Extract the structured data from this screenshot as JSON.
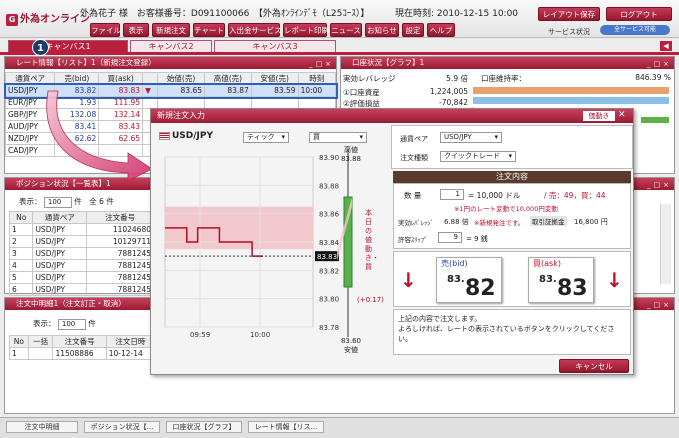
{
  "header": {
    "logo": "外為オンライン",
    "user": "外為花子 様",
    "customer_label": "お客様番号：D091100066",
    "course": "【外為ｵﾝﾗｲﾝﾃﾞﾓ（L25ｺｰｽ）】",
    "time_label": "現在時刻:",
    "time": "2010-12-15 10:00",
    "layout_save": "レイアウト保存",
    "logout": "ログアウト",
    "service_status": "サービス状況",
    "service_badge": "全サービス可能"
  },
  "menu": [
    "ファイル",
    "表示",
    "新規注文",
    "チャート",
    "入出金サービス",
    "レポート印刷",
    "ニュース",
    "お知らせ",
    "設定",
    "ヘルプ"
  ],
  "tabs": [
    "キャンバス1",
    "キャンバス2",
    "キャンバス3"
  ],
  "step_number": "1",
  "rate_panel": {
    "title": "レート情報【リスト】1（新規注文登録）",
    "headers": [
      "通貨ペア",
      "売(bid)",
      "買(ask)",
      "",
      "始値(売)",
      "高値(売)",
      "安値(売)",
      "時刻"
    ],
    "rows": [
      {
        "pair": "USD/JPY",
        "bid": "83.82",
        "ask": "83.83",
        "open": "83.65",
        "high": "83.87",
        "low": "83.59",
        "time": "10:00"
      },
      {
        "pair": "EUR/JPY",
        "bid": "1.93",
        "ask": "111.95",
        "open": "",
        "high": "",
        "low": "",
        "time": ""
      },
      {
        "pair": "GBP/JPY",
        "bid": "132.08",
        "ask": "132.14",
        "open": "",
        "high": "",
        "low": "",
        "time": ""
      },
      {
        "pair": "AUD/JPY",
        "bid": "83.41",
        "ask": "83.43",
        "open": "",
        "high": "",
        "low": "",
        "time": ""
      },
      {
        "pair": "NZD/JPY",
        "bid": "62.62",
        "ask": "62.65",
        "open": "",
        "high": "",
        "low": "",
        "time": ""
      },
      {
        "pair": "CAD/JPY",
        "bid": "",
        "ask": "",
        "open": "",
        "high": "",
        "low": "",
        "time": ""
      }
    ]
  },
  "account_panel": {
    "title": "口座状況【グラフ】1",
    "leverage_label": "実効レバレッジ",
    "leverage": "5.9",
    "leverage_unit": "倍",
    "maintenance_label": "口座維持率：",
    "maintenance": "846.39",
    "maintenance_unit": "%",
    "rows": [
      {
        "label": "①口座資産",
        "value": "1,224,005"
      },
      {
        "label": "②評価損益",
        "value": "-70,842"
      }
    ]
  },
  "position_panel": {
    "title": "ポジション状況【一覧表】1",
    "display_label": "表示：",
    "count": "100",
    "unit": "件",
    "total": "全 6 件",
    "headers": [
      "No",
      "通貨ペア",
      "注文番号"
    ],
    "rows": [
      {
        "no": "1",
        "pair": "USD/JPY",
        "order": "11024680"
      },
      {
        "no": "2",
        "pair": "USD/JPY",
        "order": "10129711"
      },
      {
        "no": "3",
        "pair": "USD/JPY",
        "order": "7881245"
      },
      {
        "no": "4",
        "pair": "USD/JPY",
        "order": "7881245"
      },
      {
        "no": "5",
        "pair": "USD/JPY",
        "order": "7881245"
      },
      {
        "no": "6",
        "pair": "USD/JPY",
        "order": "7881245"
      }
    ]
  },
  "order_panel": {
    "title": "注文中明細1（注文訂正・取消）",
    "display_label": "表示：",
    "count": "100",
    "unit": "件",
    "headers": [
      "No",
      "一括",
      "注文番号",
      "注文日時"
    ],
    "rows": [
      {
        "no": "1",
        "order": "11508886",
        "date": "10-12-14"
      }
    ]
  },
  "modal": {
    "title": "新規注文入力",
    "close_tab": "価動き",
    "pair": "USD/JPY",
    "tick_select": "ティック",
    "side_select": "買",
    "chart_high_label": "高値",
    "chart_high": "83.88",
    "chart_low": "83.60",
    "chart_low_label": "安値",
    "chart_current": "83.83",
    "chart_change_text": "本日の値動き・買",
    "chart_change": "(+0.17)",
    "y_ticks": [
      "83.90",
      "83.88",
      "83.86",
      "83.84",
      "83.82",
      "83.80",
      "83.78"
    ],
    "x_ticks": [
      "09:59",
      "10:00"
    ],
    "pair_label": "通貨ペア",
    "pair_value": "USD/JPY",
    "order_type_label": "注文種類",
    "order_type": "クイックトレード",
    "summary_title": "注文内容",
    "qty_label": "数 量",
    "qty": "1",
    "qty_unit": "= 10,000 ドル",
    "sell_buy_info": "/ 売：49，買：44",
    "note": "※1円のレート変動で10,000円変動",
    "leverage_label": "実効ﾚﾊﾞﾚｯｼﾞ",
    "leverage": "6.88 倍",
    "leverage_note": "※新規発注です。",
    "margin_label": "取引証拠金",
    "margin": "16,800 円",
    "slippage_label": "許容ｽﾘｯﾌﾟ",
    "slippage": "9",
    "slippage_unit": "= 9 銭",
    "bid_label": "売(bid)",
    "bid_big": "82",
    "ask_label": "買(ask)",
    "ask_big": "83",
    "price_prefix": "83.",
    "confirm_text_1": "上記の内容で注文します。",
    "confirm_text_2": "よろしければ、レートの表示されているボタンをクリックしてください。",
    "cancel": "キャンセル",
    "chart_data": {
      "type": "line",
      "x": [
        "09:59",
        "09:59",
        "09:59",
        "09:59",
        "09:59",
        "10:00",
        "10:00",
        "10:00",
        "10:00",
        "10:00"
      ],
      "values": [
        83.85,
        83.85,
        83.84,
        83.85,
        83.85,
        83.84,
        83.84,
        83.84,
        83.83,
        83.83
      ],
      "ylim": [
        83.78,
        83.9
      ],
      "high": 83.88,
      "low": 83.6
    }
  },
  "bottom_tabs": [
    "注文中明細",
    "ポジション状況【...",
    "口座状況【グラフ】",
    "レート情報【リス..."
  ],
  "colors": {
    "accent": "#b8203e",
    "bid": "#1f3f9f",
    "ask": "#c0102a"
  }
}
